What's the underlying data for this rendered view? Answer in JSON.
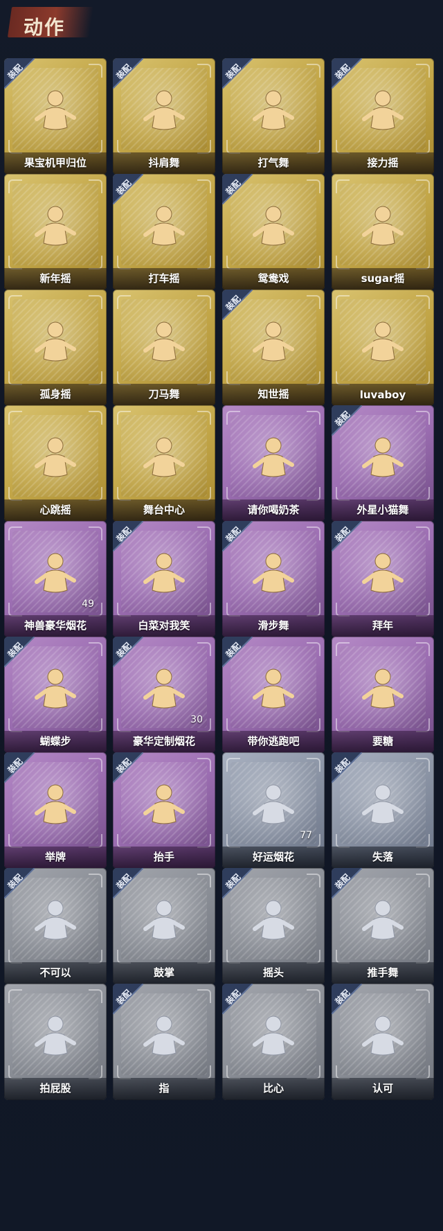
{
  "header": {
    "title": "动作"
  },
  "equip_label": "装配",
  "colors": {
    "gold": "#c4a84a",
    "purple": "#9d6fb3",
    "silver": "#8c95a6",
    "gray": "#898d95",
    "badge": "#2f3d5c"
  },
  "cards": [
    {
      "label": "果宝机甲归位",
      "tier": "gold",
      "equipped": true,
      "icon": "pose-icon",
      "count": ""
    },
    {
      "label": "抖肩舞",
      "tier": "gold",
      "equipped": true,
      "icon": "dance-icon",
      "count": ""
    },
    {
      "label": "打气舞",
      "tier": "gold",
      "equipped": true,
      "icon": "dance-icon",
      "count": ""
    },
    {
      "label": "接力摇",
      "tier": "gold",
      "equipped": true,
      "icon": "dance-icon",
      "count": ""
    },
    {
      "label": "新年摇",
      "tier": "gold",
      "equipped": false,
      "icon": "dance-icon",
      "count": ""
    },
    {
      "label": "打车摇",
      "tier": "gold",
      "equipped": true,
      "icon": "dance-icon",
      "count": ""
    },
    {
      "label": "鸳鸯戏",
      "tier": "gold",
      "equipped": true,
      "icon": "dance-icon",
      "count": ""
    },
    {
      "label": "sugar摇",
      "tier": "gold",
      "equipped": false,
      "icon": "dance-icon",
      "count": ""
    },
    {
      "label": "孤身摇",
      "tier": "gold",
      "equipped": false,
      "icon": "dance-icon",
      "count": ""
    },
    {
      "label": "刀马舞",
      "tier": "gold",
      "equipped": false,
      "icon": "dance-icon",
      "count": ""
    },
    {
      "label": "知世摇",
      "tier": "gold",
      "equipped": true,
      "icon": "dance-icon",
      "count": ""
    },
    {
      "label": "luvaboy",
      "tier": "gold",
      "equipped": false,
      "icon": "dance-icon",
      "count": ""
    },
    {
      "label": "心跳摇",
      "tier": "gold",
      "equipped": false,
      "icon": "dance-icon",
      "count": ""
    },
    {
      "label": "舞台中心",
      "tier": "gold",
      "equipped": false,
      "icon": "dance-icon",
      "count": ""
    },
    {
      "label": "请你喝奶茶",
      "tier": "purple",
      "equipped": false,
      "icon": "banner-icon",
      "count": ""
    },
    {
      "label": "外星小猫舞",
      "tier": "purple",
      "equipped": true,
      "icon": "dance-icon",
      "count": ""
    },
    {
      "label": "神兽豪华烟花",
      "tier": "purple",
      "equipped": false,
      "icon": "firework-icon",
      "count": "49"
    },
    {
      "label": "白菜对我笑",
      "tier": "purple",
      "equipped": true,
      "icon": "dance-icon",
      "count": ""
    },
    {
      "label": "滑步舞",
      "tier": "purple",
      "equipped": true,
      "icon": "dance-icon",
      "count": ""
    },
    {
      "label": "拜年",
      "tier": "purple",
      "equipped": true,
      "icon": "bow-icon",
      "count": ""
    },
    {
      "label": "蝴蝶步",
      "tier": "purple",
      "equipped": true,
      "icon": "dance-icon",
      "count": ""
    },
    {
      "label": "豪华定制烟花",
      "tier": "purple",
      "equipped": true,
      "icon": "firework-icon",
      "count": "30"
    },
    {
      "label": "带你逃跑吧",
      "tier": "purple",
      "equipped": true,
      "icon": "dance-icon",
      "count": ""
    },
    {
      "label": "要糖",
      "tier": "purple",
      "equipped": false,
      "icon": "beg-icon",
      "count": ""
    },
    {
      "label": "举牌",
      "tier": "purple",
      "equipped": true,
      "icon": "sign-icon",
      "count": ""
    },
    {
      "label": "抬手",
      "tier": "purple",
      "equipped": true,
      "icon": "hand-icon",
      "count": ""
    },
    {
      "label": "好运烟花",
      "tier": "silver",
      "equipped": false,
      "icon": "firework-icon",
      "count": "77"
    },
    {
      "label": "失落",
      "tier": "silver",
      "equipped": true,
      "icon": "crawl-icon",
      "count": ""
    },
    {
      "label": "不可以",
      "tier": "gray",
      "equipped": true,
      "icon": "finger-icon",
      "count": ""
    },
    {
      "label": "鼓掌",
      "tier": "gray",
      "equipped": true,
      "icon": "clap-icon",
      "count": ""
    },
    {
      "label": "摇头",
      "tier": "gray",
      "equipped": true,
      "icon": "shake-icon",
      "count": ""
    },
    {
      "label": "推手舞",
      "tier": "gray",
      "equipped": true,
      "icon": "push-icon",
      "count": ""
    },
    {
      "label": "拍屁股",
      "tier": "gray",
      "equipped": false,
      "icon": "run-icon",
      "count": ""
    },
    {
      "label": "指",
      "tier": "gray",
      "equipped": true,
      "icon": "point-icon",
      "count": ""
    },
    {
      "label": "比心",
      "tier": "gray",
      "equipped": true,
      "icon": "heart-icon",
      "count": ""
    },
    {
      "label": "认可",
      "tier": "gray",
      "equipped": true,
      "icon": "thumb-icon",
      "count": ""
    }
  ]
}
